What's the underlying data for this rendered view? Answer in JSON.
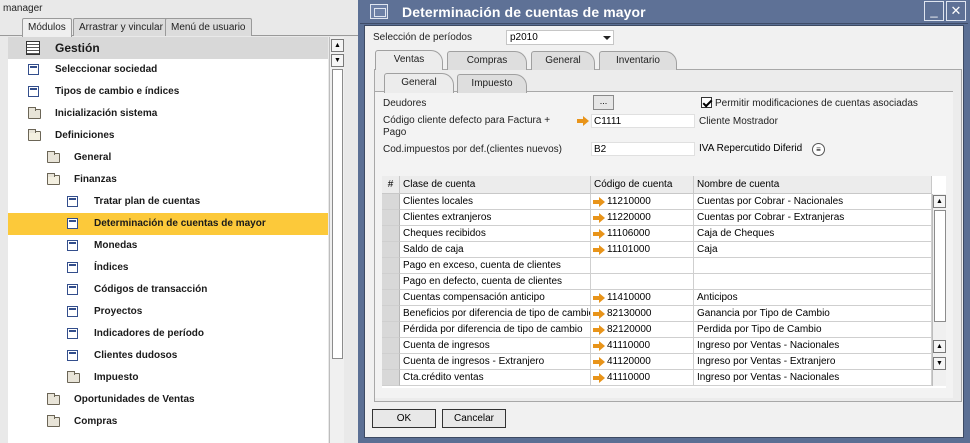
{
  "left": {
    "user_label": "manager",
    "tabs": [
      "Módulos",
      "Arrastrar y vincular",
      "Menú de usuario"
    ],
    "menu": [
      {
        "label": "Gestión",
        "icon": "module-icon",
        "level": 0
      },
      {
        "label": "Seleccionar sociedad",
        "icon": "form-icon",
        "level": 0
      },
      {
        "label": "Tipos de cambio e índices",
        "icon": "form-icon",
        "level": 0
      },
      {
        "label": "Inicialización sistema",
        "icon": "folder-icon",
        "level": 0
      },
      {
        "label": "Definiciones",
        "icon": "folder-open-icon",
        "level": 0
      },
      {
        "label": "General",
        "icon": "folder-icon",
        "level": 1
      },
      {
        "label": "Finanzas",
        "icon": "folder-open-icon",
        "level": 1
      },
      {
        "label": "Tratar plan de cuentas",
        "icon": "form-icon",
        "level": 2
      },
      {
        "label": "Determinación de cuentas de mayor",
        "icon": "form-icon",
        "level": 2,
        "selected": true
      },
      {
        "label": "Monedas",
        "icon": "form-icon",
        "level": 2
      },
      {
        "label": "Índices",
        "icon": "form-icon",
        "level": 2
      },
      {
        "label": "Códigos de transacción",
        "icon": "form-icon",
        "level": 2
      },
      {
        "label": "Proyectos",
        "icon": "form-icon",
        "level": 2
      },
      {
        "label": "Indicadores de período",
        "icon": "form-icon",
        "level": 2
      },
      {
        "label": "Clientes dudosos",
        "icon": "form-icon",
        "level": 2
      },
      {
        "label": "Impuesto",
        "icon": "folder-icon",
        "level": 2
      },
      {
        "label": "Oportunidades de Ventas",
        "icon": "folder-icon",
        "level": 1
      },
      {
        "label": "Compras",
        "icon": "folder-icon",
        "level": 1
      }
    ]
  },
  "window": {
    "title": "Determinación de cuentas de mayor",
    "period_label": "Selección de períodos",
    "period_value": "p2010",
    "tabs": [
      "Ventas",
      "Compras",
      "General",
      "Inventario"
    ],
    "subtabs": [
      "General",
      "Impuesto"
    ],
    "deudores_label": "Deudores",
    "deudores_button": "...",
    "permitir_label": "Permitir modificaciones de cuentas asociadas",
    "codigo_cliente_label": "Código cliente defecto para Factura + Pago",
    "codigo_cliente_value": "C1111",
    "codigo_cliente_name": "Cliente Mostrador",
    "cod_impuestos_label": "Cod.impuestos por def.(clientes nuevos)",
    "cod_impuestos_value": "B2",
    "cod_impuestos_name": "IVA Repercutido Diferid",
    "list_button": "≡",
    "columns": [
      "#",
      "Clase de cuenta",
      "Código de cuenta",
      "Nombre de cuenta"
    ],
    "rows": [
      {
        "clase": "Clientes locales",
        "codigo": "11210000",
        "nombre": "Cuentas por Cobrar - Nacionales"
      },
      {
        "clase": "Clientes extranjeros",
        "codigo": "11220000",
        "nombre": "Cuentas por Cobrar - Extranjeras"
      },
      {
        "clase": "Cheques recibidos",
        "codigo": "11106000",
        "nombre": "Caja de Cheques"
      },
      {
        "clase": "Saldo de caja",
        "codigo": "11101000",
        "nombre": "Caja"
      },
      {
        "clase": "Pago en exceso, cuenta de clientes",
        "codigo": "",
        "nombre": ""
      },
      {
        "clase": "Pago en defecto, cuenta de clientes",
        "codigo": "",
        "nombre": ""
      },
      {
        "clase": "Cuentas compensación anticipo",
        "codigo": "11410000",
        "nombre": "Anticipos"
      },
      {
        "clase": "Beneficios por diferencia de tipo de cambio",
        "codigo": "82130000",
        "nombre": "Ganancia por Tipo de Cambio"
      },
      {
        "clase": "Pérdida por diferencia de tipo de cambio",
        "codigo": "82120000",
        "nombre": "Perdida por Tipo de Cambio"
      },
      {
        "clase": "Cuenta de ingresos",
        "codigo": "41110000",
        "nombre": "Ingreso por Ventas - Nacionales"
      },
      {
        "clase": "Cuenta de ingresos - Extranjero",
        "codigo": "41120000",
        "nombre": "Ingreso por Ventas - Extranjero"
      },
      {
        "clase": "Cta.crédito ventas",
        "codigo": "41110000",
        "nombre": "Ingreso por Ventas - Nacionales"
      }
    ],
    "ok_label": "OK",
    "cancel_label": "Cancelar"
  }
}
